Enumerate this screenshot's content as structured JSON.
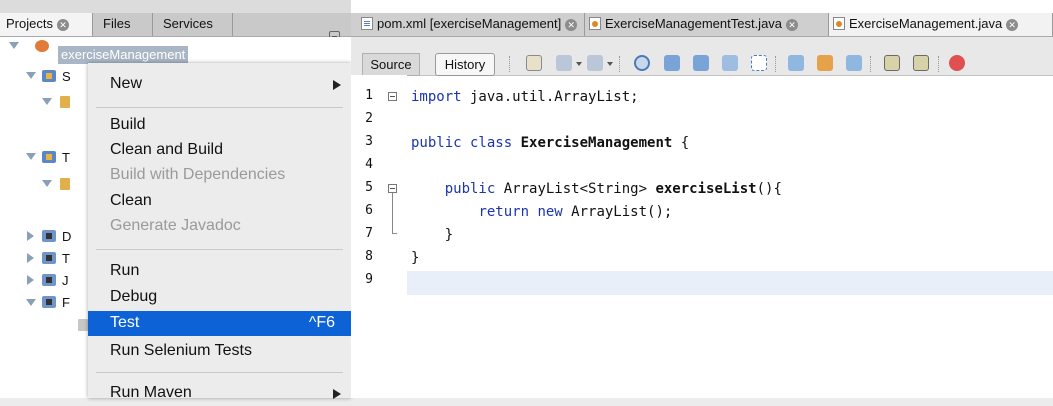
{
  "left_panel": {
    "tabs": [
      {
        "label": "Projects",
        "active": true,
        "closable": true
      },
      {
        "label": "Files",
        "active": false
      },
      {
        "label": "Services",
        "active": false
      }
    ],
    "project": {
      "name": "exerciseManagement",
      "partial_labels": [
        "S",
        "T",
        "D",
        "T",
        "J",
        "F"
      ]
    }
  },
  "context_menu": {
    "items": [
      {
        "label": "New",
        "submenu": true,
        "disabled": false
      },
      {
        "label": "Build",
        "disabled": false
      },
      {
        "label": "Clean and Build",
        "disabled": false
      },
      {
        "label": "Build with Dependencies",
        "disabled": true
      },
      {
        "label": "Clean",
        "disabled": false
      },
      {
        "label": "Generate Javadoc",
        "disabled": true
      },
      {
        "label": "Run",
        "disabled": false
      },
      {
        "label": "Debug",
        "disabled": false
      },
      {
        "label": "Test",
        "shortcut": "^F6",
        "selected": true
      },
      {
        "label": "Run Selenium Tests",
        "disabled": false
      },
      {
        "label": "Run Maven",
        "submenu": true,
        "disabled": false
      }
    ]
  },
  "editor": {
    "tabs": [
      {
        "label": "pom.xml [exerciseManagement]",
        "icon": "xml-file-icon",
        "active": false
      },
      {
        "label": "ExerciseManagementTest.java",
        "icon": "java-file-icon",
        "active": false
      },
      {
        "label": "ExerciseManagement.java",
        "icon": "java-file-icon",
        "active": true
      }
    ],
    "toolbar": {
      "source_label": "Source",
      "history_label": "History",
      "icons": [
        "back-icon",
        "prev-edit-icon",
        "next-edit-icon",
        "find-selection-icon",
        "find-prev-icon",
        "find-next-icon",
        "toggle-highlight-icon",
        "toggle-rect-selection-icon",
        "prev-bookmark-icon",
        "next-bookmark-icon",
        "toggle-bookmark-icon",
        "shift-left-icon",
        "shift-right-icon",
        "start-macro-icon"
      ]
    },
    "line_numbers": [
      "1",
      "2",
      "3",
      "4",
      "5",
      "6",
      "7",
      "8",
      "9"
    ],
    "code": {
      "l1_kw": "import",
      "l1_rest": " java.util.ArrayList;",
      "l3_kw": "public class",
      "l3_name": "ExerciseManagement",
      "l3_rest": " {",
      "l5_kw": "public",
      "l5_type": " ArrayList<String> ",
      "l5_name": "exerciseList",
      "l5_rest": "(){",
      "l6_kw": "return new",
      "l6_rest": " ArrayList();",
      "l7": "}",
      "l8": "}"
    },
    "current_line": 9
  },
  "colors": {
    "keyword": "#1a35b0",
    "menu_selected": "#0d63d6",
    "current_line": "#e9eff8"
  }
}
